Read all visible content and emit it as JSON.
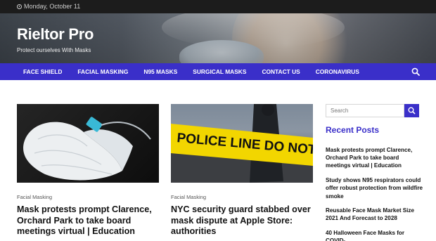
{
  "topbar": {
    "date": "Monday, October 11"
  },
  "site": {
    "title": "Rieltor Pro",
    "tagline": "Protect ourselves With Masks"
  },
  "nav": {
    "items": [
      {
        "label": "FACE SHIELD"
      },
      {
        "label": "FACIAL MASKING"
      },
      {
        "label": "N95 MASKS"
      },
      {
        "label": "SURGICAL MASKS"
      },
      {
        "label": "CONTACT US"
      },
      {
        "label": "CORONAVIRUS"
      }
    ],
    "search_icon": "search-icon"
  },
  "posts": [
    {
      "category": "Facial Masking",
      "title": "Mask protests prompt Clarence, Orchard Park to take board meetings virtual | Education",
      "image": "n95-respirator-mask"
    },
    {
      "category": "Facial Masking",
      "title": "NYC security guard stabbed over mask dispute at Apple Store: authorities",
      "image": "police-line-tape"
    }
  ],
  "sidebar": {
    "search": {
      "placeholder": "Search"
    },
    "recent_title": "Recent Posts",
    "recent_posts": [
      "Mask protests prompt Clarence, Orchard Park to take board meetings virtual | Education",
      "Study shows N95 respirators could offer robust protection from wildfire smoke",
      "Reusable Face Mask Market Size 2021 And Forecast to 2028",
      "40 Halloween Face Masks for COVID-"
    ]
  },
  "thumb_text": {
    "police_tape": "POLICE LINE DO NOT CROSS"
  },
  "colors": {
    "accent": "#3a2fc9",
    "topbar": "#1c1c1c",
    "tape": "#f2d600"
  }
}
